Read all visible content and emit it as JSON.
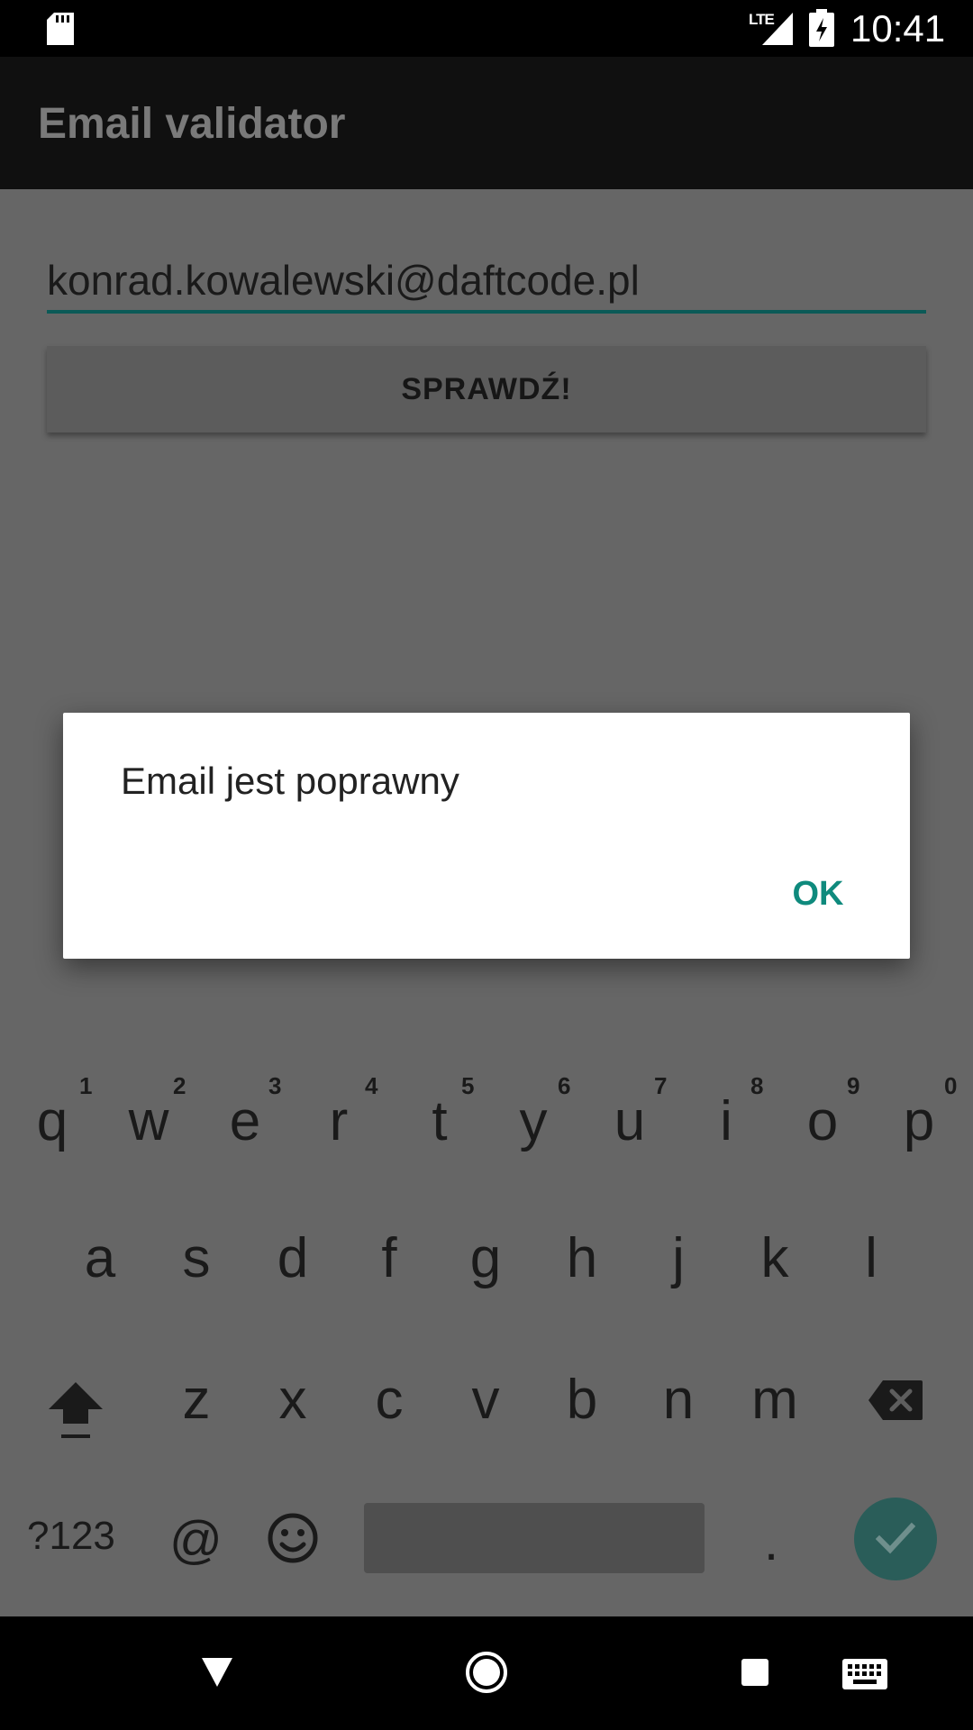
{
  "status_bar": {
    "network_label": "LTE",
    "time": "10:41",
    "icons": [
      "sd-card-icon",
      "signal-icon",
      "battery-charging-icon"
    ]
  },
  "app_bar": {
    "title": "Email validator"
  },
  "form": {
    "email_value": "konrad.kowalewski@daftcode.pl",
    "check_button_label": "SPRAWDŹ!"
  },
  "dialog": {
    "message": "Email jest poprawny",
    "ok_label": "OK"
  },
  "keyboard": {
    "row1": [
      {
        "key": "q",
        "hint": "1"
      },
      {
        "key": "w",
        "hint": "2"
      },
      {
        "key": "e",
        "hint": "3"
      },
      {
        "key": "r",
        "hint": "4"
      },
      {
        "key": "t",
        "hint": "5"
      },
      {
        "key": "y",
        "hint": "6"
      },
      {
        "key": "u",
        "hint": "7"
      },
      {
        "key": "i",
        "hint": "8"
      },
      {
        "key": "o",
        "hint": "9"
      },
      {
        "key": "p",
        "hint": "0"
      }
    ],
    "row2": [
      "a",
      "s",
      "d",
      "f",
      "g",
      "h",
      "j",
      "k",
      "l"
    ],
    "row3": [
      "z",
      "x",
      "c",
      "v",
      "b",
      "n",
      "m"
    ],
    "symbols_label": "?123",
    "at_label": "@",
    "period_label": ".",
    "special_icons": [
      "shift-icon",
      "backspace-icon",
      "emoji-icon",
      "checkmark-icon"
    ]
  },
  "nav_bar": {
    "icons": [
      "back-icon",
      "home-icon",
      "recents-icon",
      "keyboard-switch-icon"
    ]
  },
  "colors": {
    "accent": "#0f8a7d",
    "input_underline": "#0b5a57",
    "scrim_bg": "#666666",
    "enter_key_bg": "#2a5d59"
  }
}
